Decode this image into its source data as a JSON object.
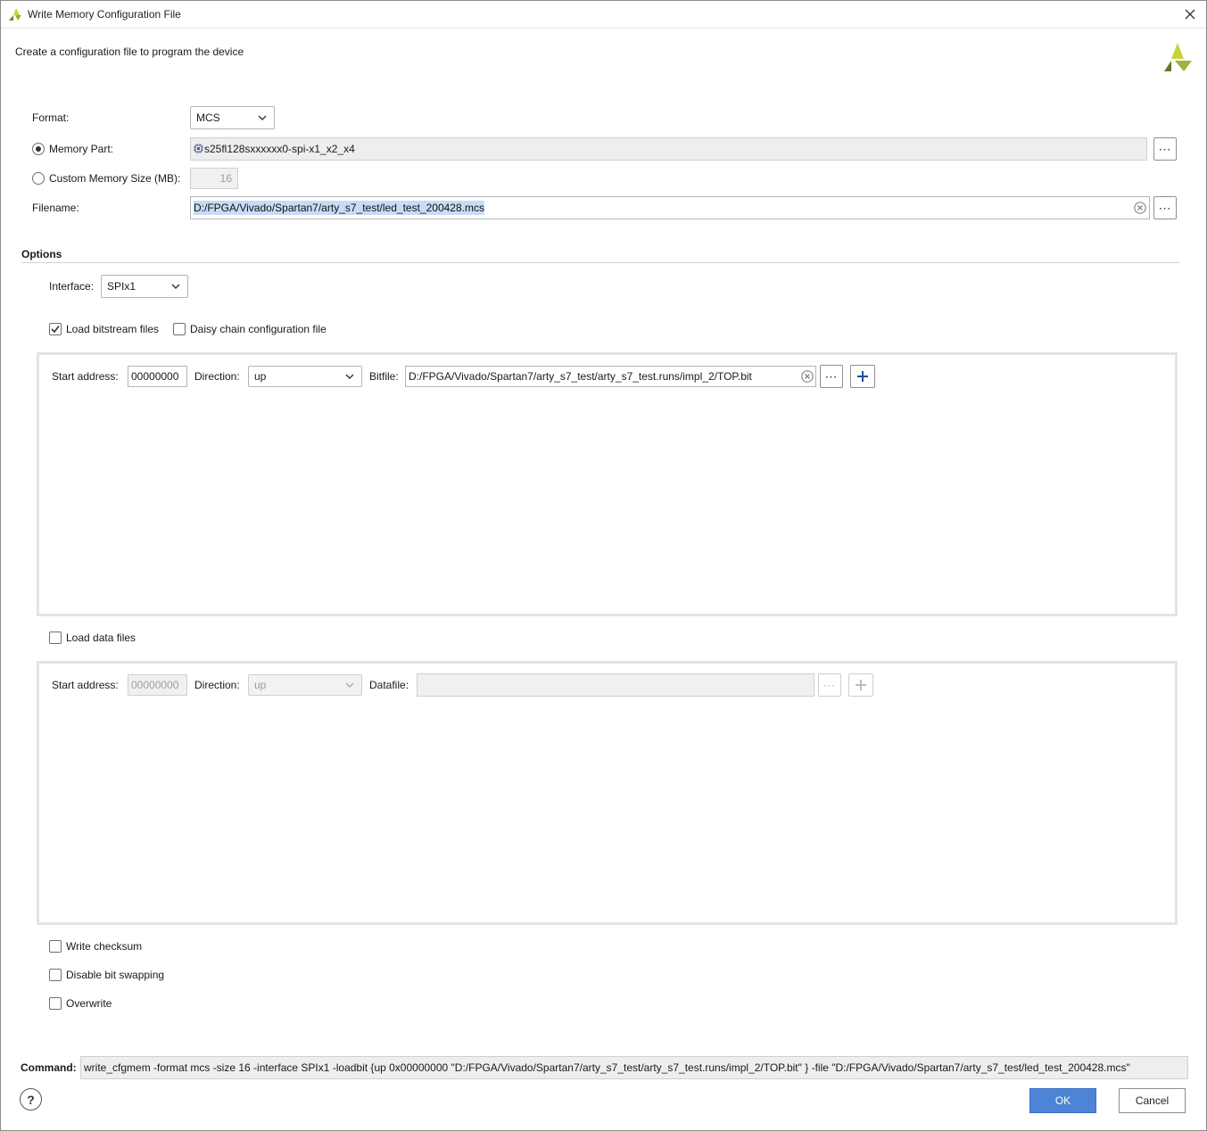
{
  "window": {
    "title": "Write Memory Configuration File",
    "subtitle": "Create a configuration file to program the device"
  },
  "form": {
    "format_label": "Format:",
    "format_value": "MCS",
    "memory_part_label": "Memory Part:",
    "memory_part_value": "s25fl128sxxxxxx0-spi-x1_x2_x4",
    "memory_part_selected": true,
    "custom_size_label": "Custom Memory Size (MB):",
    "custom_size_value": "16",
    "custom_size_selected": false,
    "filename_label": "Filename:",
    "filename_value": "D:/FPGA/Vivado/Spartan7/arty_s7_test/led_test_200428.mcs"
  },
  "options": {
    "title": "Options",
    "interface_label": "Interface:",
    "interface_value": "SPIx1",
    "load_bitstream_label": "Load bitstream files",
    "load_bitstream_checked": true,
    "daisy_chain_label": "Daisy chain configuration file",
    "daisy_chain_checked": false,
    "bitstream": {
      "start_address_label": "Start address:",
      "start_address_value": "00000000",
      "direction_label": "Direction:",
      "direction_value": "up",
      "file_label": "Bitfile:",
      "file_value": "D:/FPGA/Vivado/Spartan7/arty_s7_test/arty_s7_test.runs/impl_2/TOP.bit"
    },
    "load_data_label": "Load data files",
    "load_data_checked": false,
    "data": {
      "start_address_label": "Start address:",
      "start_address_value": "00000000",
      "direction_label": "Direction:",
      "direction_value": "up",
      "file_label": "Datafile:",
      "file_value": ""
    },
    "write_checksum_label": "Write checksum",
    "disable_bit_swapping_label": "Disable bit swapping",
    "overwrite_label": "Overwrite"
  },
  "command": {
    "label": "Command:",
    "value": "write_cfgmem  -format mcs -size 16 -interface SPIx1 -loadbit {up 0x00000000 \"D:/FPGA/Vivado/Spartan7/arty_s7_test/arty_s7_test.runs/impl_2/TOP.bit\" } -file \"D:/FPGA/Vivado/Spartan7/arty_s7_test/led_test_200428.mcs\""
  },
  "buttons": {
    "help": "?",
    "ok": "OK",
    "cancel": "Cancel",
    "browse": "⋯"
  },
  "colors": {
    "accent": "#4d84d5",
    "brand_light": "#c8d43a",
    "brand_dark": "#5f7a2a"
  }
}
